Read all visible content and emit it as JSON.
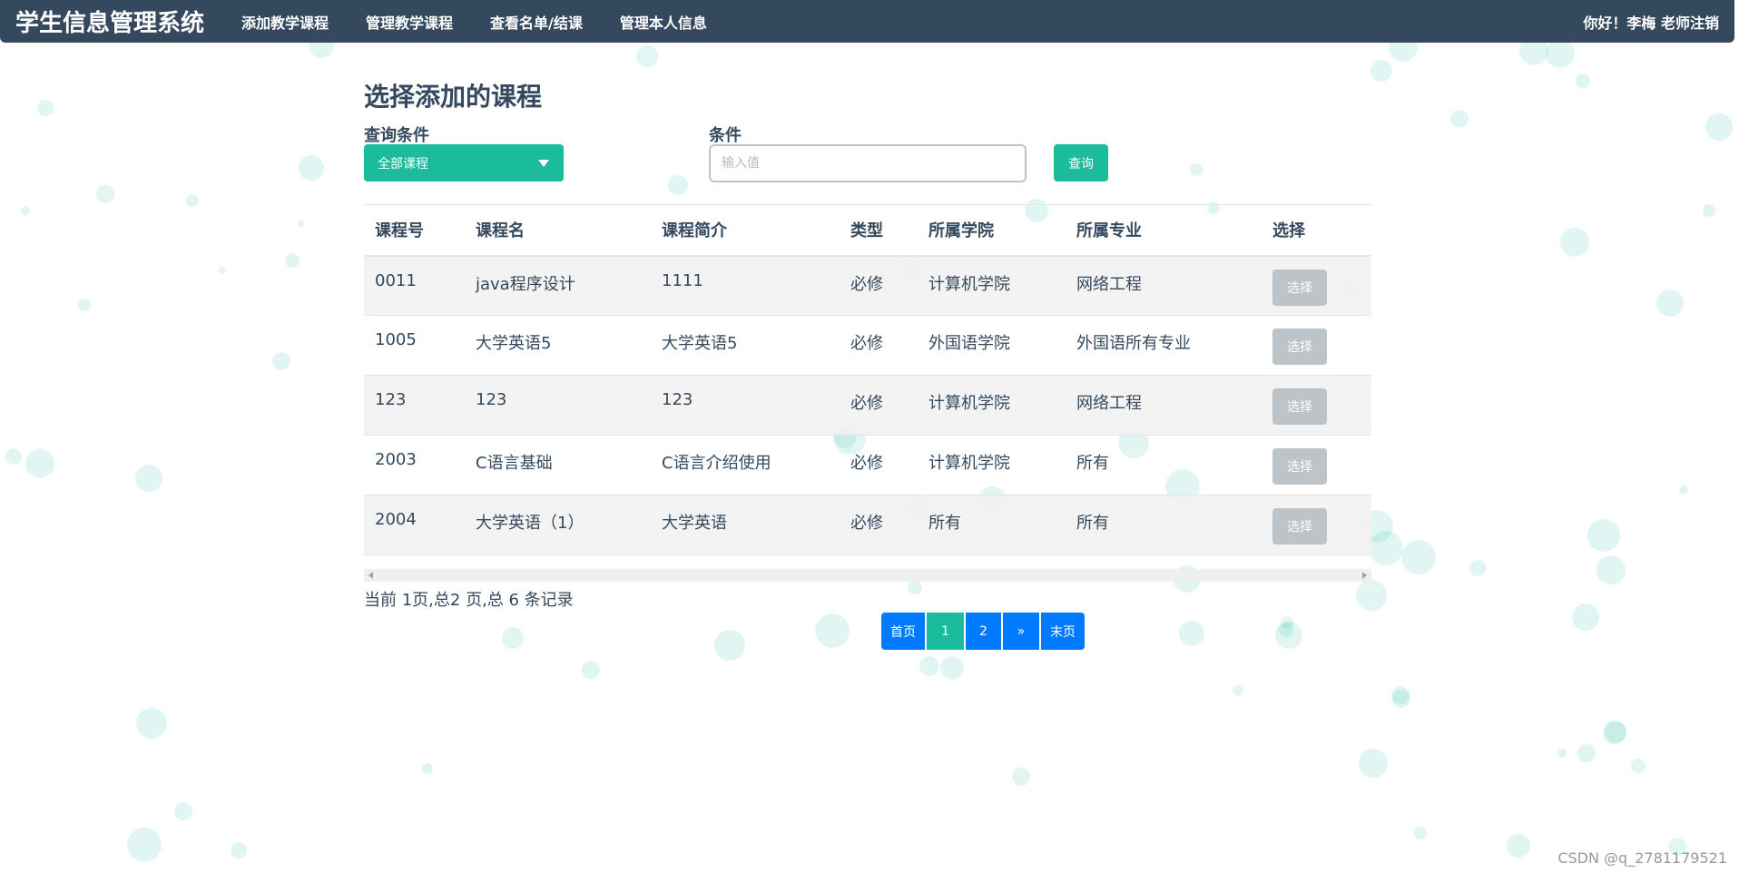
{
  "navbar": {
    "brand": "学生信息管理系统",
    "menu": [
      "添加教学课程",
      "管理教学课程",
      "查看名单/结课",
      "管理本人信息"
    ],
    "greeting": "你好！李梅 老师",
    "logout": "注销"
  },
  "page": {
    "title": "选择添加的课程"
  },
  "filters": {
    "condition_label": "查询条件",
    "condition_value": "全部课程",
    "value_label": "条件",
    "value_placeholder": "输入值",
    "query_button": "查询"
  },
  "table": {
    "headers": [
      "课程号",
      "课程名",
      "课程简介",
      "类型",
      "所属学院",
      "所属专业",
      "选择"
    ],
    "select_label": "选择",
    "rows": [
      [
        "0011",
        "java程序设计",
        "1111",
        "必修",
        "计算机学院",
        "网络工程"
      ],
      [
        "1005",
        "大学英语5",
        "大学英语5",
        "必修",
        "外国语学院",
        "外国语所有专业"
      ],
      [
        "123",
        "123",
        "123",
        "必修",
        "计算机学院",
        "网络工程"
      ],
      [
        "2003",
        "C语言基础",
        "C语言介绍使用",
        "必修",
        "计算机学院",
        "所有"
      ],
      [
        "2004",
        "大学英语（1）",
        "大学英语",
        "必修",
        "所有",
        "所有"
      ]
    ]
  },
  "pagination": {
    "info": "当前 1页,总2 页,总 6 条记录",
    "first": "首页",
    "pages": [
      "1",
      "2"
    ],
    "next": "»",
    "last": "末页",
    "current": 1
  },
  "watermark": "CSDN @q_2781179521",
  "colors": {
    "navbar": "#34495e",
    "accent": "#1abc9c",
    "pager": "#007bff",
    "select_button": "#bdc3c7"
  }
}
